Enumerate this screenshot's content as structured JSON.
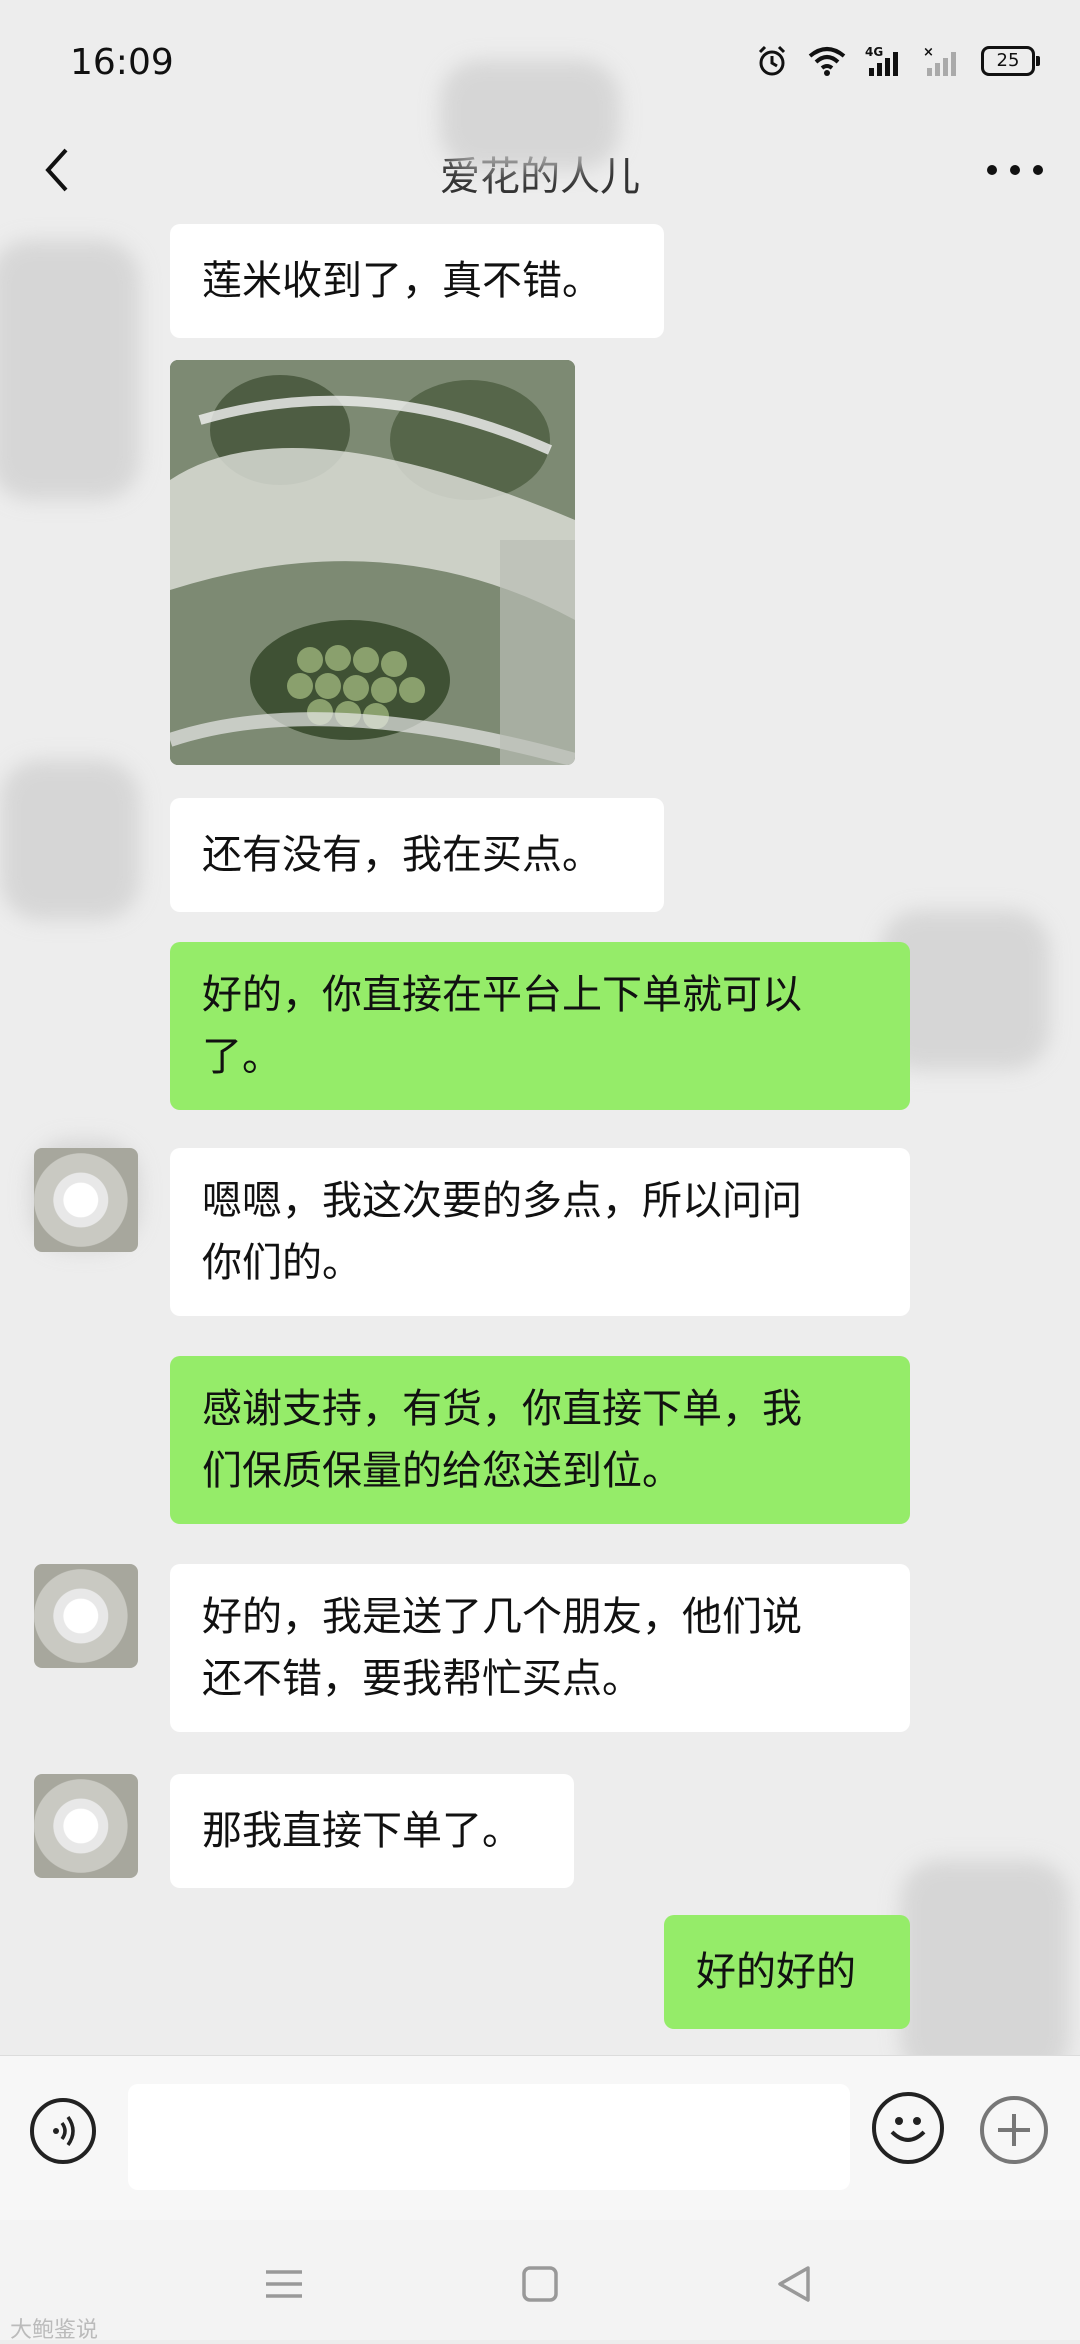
{
  "status_bar": {
    "time": "16:09",
    "battery": "25",
    "icons": [
      "alarm-icon",
      "wifi-icon",
      "signal-4g-icon",
      "signal-no-sim-icon",
      "battery-icon"
    ]
  },
  "header": {
    "title": "爱花的人儿",
    "back_icon": "chevron-left-icon",
    "more_icon": "more-dots-icon"
  },
  "messages": [
    {
      "side": "in",
      "text": "莲米收到了，真不错。"
    },
    {
      "side": "in",
      "type": "image",
      "description_icon": "photo-lotus-seeds"
    },
    {
      "side": "in",
      "text": "还有没有，我在买点。"
    },
    {
      "side": "out",
      "lines": [
        "好的，你直接在平台上下单就可以",
        "了。"
      ]
    },
    {
      "side": "in",
      "lines": [
        "嗯嗯，我这次要的多点，所以问问",
        "你们的。"
      ]
    },
    {
      "side": "out",
      "lines": [
        "感谢支持，有货，你直接下单，我",
        "们保质保量的给您送到位。"
      ]
    },
    {
      "side": "in",
      "lines": [
        "好的，我是送了几个朋友，他们说",
        "还不错，要我帮忙买点。"
      ]
    },
    {
      "side": "in",
      "text": "那我直接下单了。"
    },
    {
      "side": "out",
      "text": "好的好的"
    }
  ],
  "input_bar": {
    "placeholder": "",
    "icons": [
      "voice-icon",
      "emoji-icon",
      "plus-icon"
    ]
  },
  "nav_bar": {
    "icons": [
      "menu-icon",
      "home-square-icon",
      "back-triangle-icon"
    ]
  },
  "watermark": "大鲍鉴说",
  "colors": {
    "background": "#ededed",
    "outgoing_bubble": "#95ec69",
    "incoming_bubble": "#ffffff"
  }
}
